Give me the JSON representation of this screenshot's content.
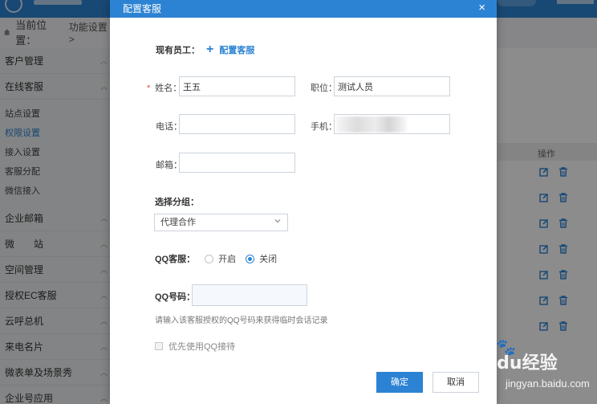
{
  "app": {
    "breadcrumb": {
      "current_label": "当前位置：",
      "section": "功能设置 >"
    },
    "sidebar": {
      "groups_top": [
        {
          "label": "客户管理"
        },
        {
          "label": "在线客服"
        }
      ],
      "sub_items": [
        {
          "label": "站点设置",
          "active": false
        },
        {
          "label": "权限设置",
          "active": true
        },
        {
          "label": "接入设置",
          "active": false
        },
        {
          "label": "客服分配",
          "active": false
        },
        {
          "label": "微信接入",
          "active": false
        }
      ],
      "groups_bottom": [
        {
          "label": "企业邮箱"
        },
        {
          "label": "微　　站"
        },
        {
          "label": "空间管理"
        },
        {
          "label": "授权EC客服"
        },
        {
          "label": "云呼总机"
        },
        {
          "label": "来电名片"
        },
        {
          "label": "微表单及场景秀"
        },
        {
          "label": "企业号应用"
        }
      ]
    },
    "table": {
      "action_header": "操作"
    }
  },
  "modal": {
    "title": "配置客服",
    "close_glyph": "×",
    "existing_staff_label": "现有员工：",
    "add_icon_glyph": "+",
    "add_link": "配置客服",
    "name": {
      "required_mark": "*",
      "label": "姓名：",
      "value": "王五"
    },
    "position": {
      "label": "职位：",
      "value": "测试人员"
    },
    "phone": {
      "label": "电话：",
      "value": ""
    },
    "mobile": {
      "label": "手机：",
      "value": ""
    },
    "email": {
      "label": "邮箱：",
      "value": ""
    },
    "group": {
      "label": "选择分组：",
      "selected": "代理合作"
    },
    "qq_service": {
      "label": "QQ客服：",
      "options": [
        {
          "label": "开启",
          "checked": false
        },
        {
          "label": "关闭",
          "checked": true
        }
      ]
    },
    "qq_number": {
      "label": "QQ号码：",
      "value": ""
    },
    "hint": "请输入该客服授权的QQ号码来获得临时会话记录",
    "prefer_qq": {
      "label": "优先使用QQ接待",
      "checked": false
    },
    "ok_label": "确定",
    "cancel_label": "取消"
  },
  "watermark": {
    "main": "Baidu经验",
    "sub": "jingyan.baidu.com"
  },
  "colors": {
    "accent": "#2c83d3",
    "required": "#e04a4a"
  },
  "icons": {
    "edit": "edit-icon",
    "delete": "trash-icon",
    "home": "home-icon",
    "caret": "chevron-down-icon"
  }
}
